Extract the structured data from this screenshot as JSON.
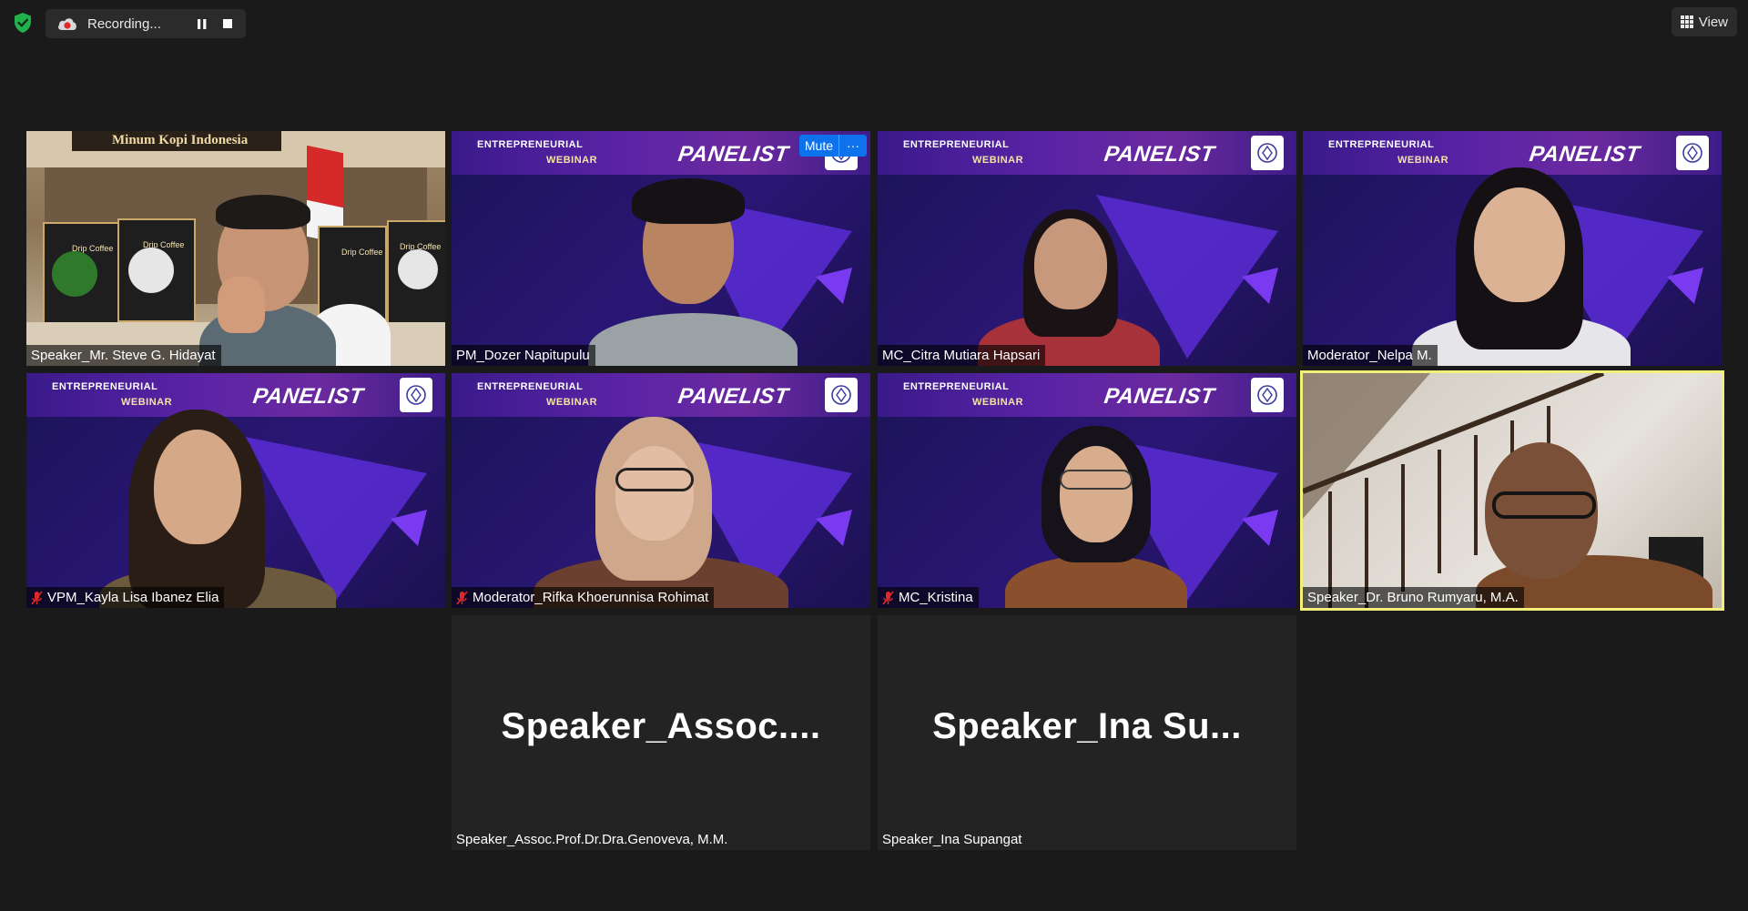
{
  "topbar": {
    "recording_text": "Recording...",
    "view_label": "View"
  },
  "banner": {
    "line1": "ENTREPRENEURIAL",
    "line2": "WEBINAR",
    "tag": "PANELIST"
  },
  "hover_controls": {
    "mute_label": "Mute",
    "more_label": "···"
  },
  "participants": [
    {
      "name": "Speaker_Mr. Steve G. Hidayat",
      "muted": false
    },
    {
      "name": "PM_Dozer Napitupulu",
      "muted": false
    },
    {
      "name": "MC_Citra Mutiara Hapsari",
      "muted": false
    },
    {
      "name": "Moderator_Nelpa M.",
      "muted": false
    },
    {
      "name": "VPM_Kayla Lisa Ibanez Elia",
      "muted": true
    },
    {
      "name": "Moderator_Rifka Khoerunnisa Rohimat",
      "muted": true
    },
    {
      "name": "MC_Kristina",
      "muted": true
    },
    {
      "name": "Speaker_Dr. Bruno Rumyaru, M.A.",
      "muted": false,
      "active_speaker": true
    },
    {
      "name": "Speaker_Assoc.Prof.Dr.Dra.Genoveva, M.M.",
      "avatar_text": "Speaker_Assoc....",
      "video": false
    },
    {
      "name": "Speaker_Ina Supangat",
      "avatar_text": "Speaker_Ina  Su...",
      "video": false
    }
  ],
  "scene_text": {
    "coffee_sign": "Minum Kopi Indonesia",
    "coffee_pack": "Drip Coffee"
  },
  "colors": {
    "background": "#1a1a1a",
    "active_outline": "#f2f07a",
    "mute_red": "#e02828",
    "button_blue": "#0e72ed",
    "security_green": "#22b14c"
  }
}
